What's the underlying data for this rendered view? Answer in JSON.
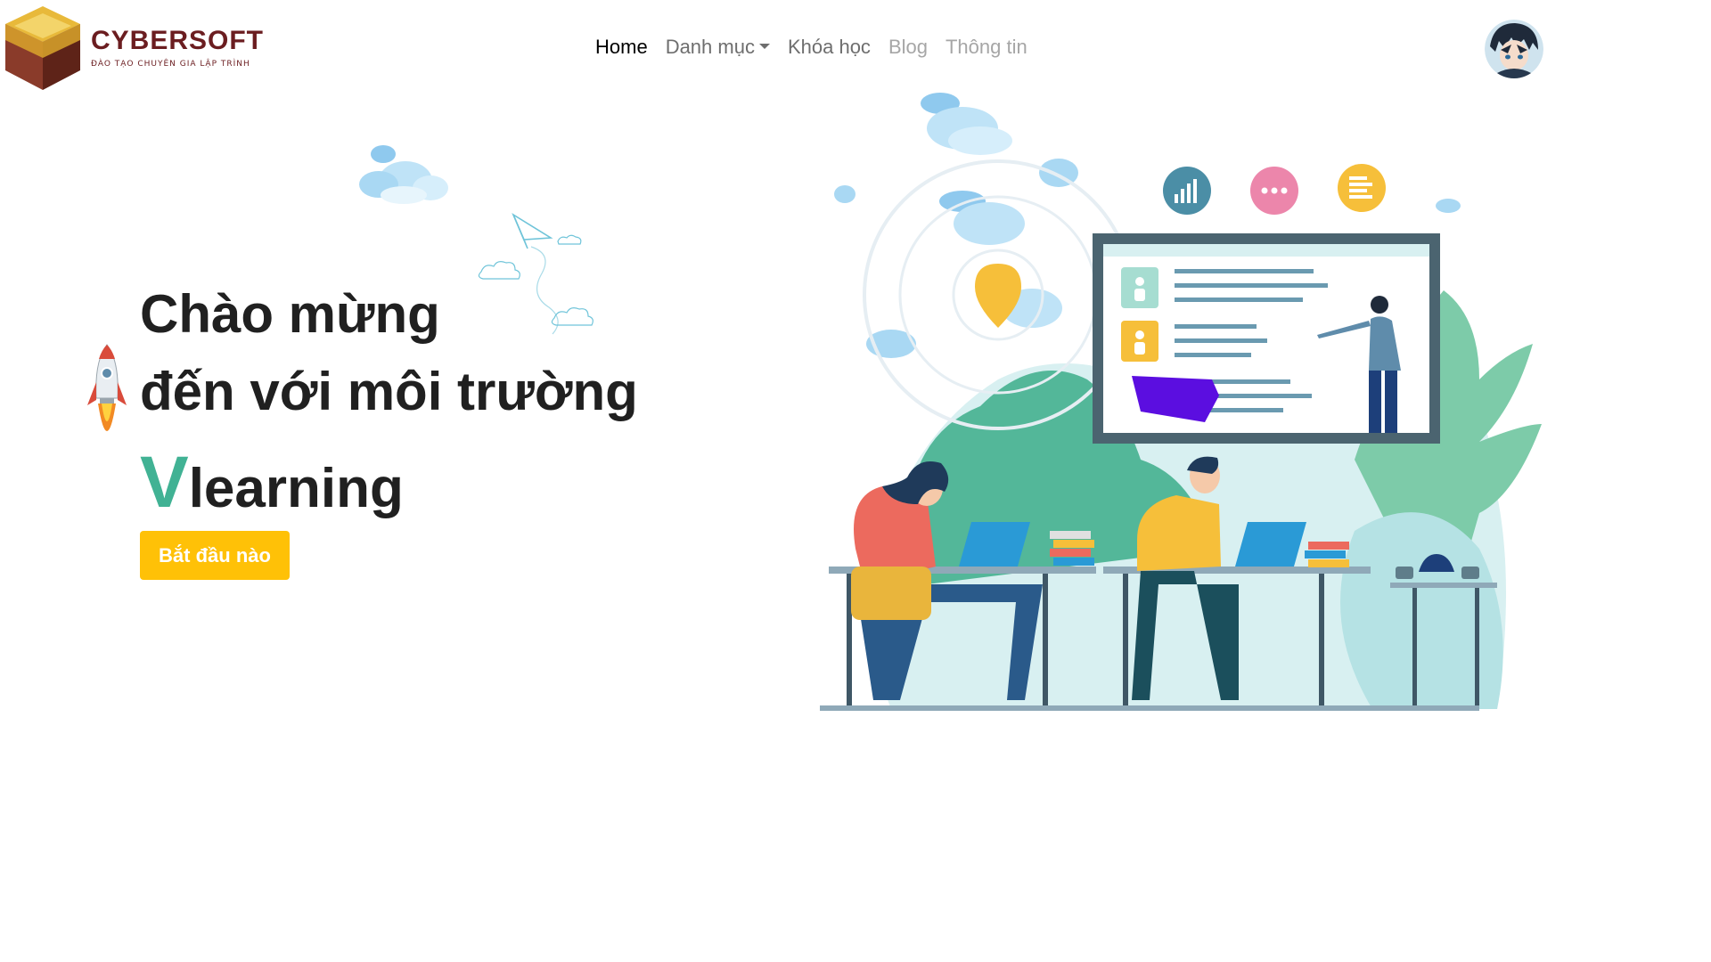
{
  "brand": {
    "name": "CYBERSOFT",
    "tagline": "ĐÀO TẠO CHUYÊN GIA LẬP TRÌNH"
  },
  "nav": {
    "items": [
      {
        "label": "Home",
        "state": "active"
      },
      {
        "label": "Danh mục",
        "state": "normal",
        "dropdown": true
      },
      {
        "label": "Khóa học",
        "state": "normal"
      },
      {
        "label": "Blog",
        "state": "muted"
      },
      {
        "label": "Thông tin",
        "state": "muted"
      }
    ]
  },
  "hero": {
    "line1": "Chào mừng",
    "line2": "đến với môi trường",
    "v_letter": "V",
    "line3_rest": "learning",
    "cta_label": "Bắt đầu nào"
  },
  "colors": {
    "accent_green": "#41b294",
    "cta_yellow": "#ffc107",
    "brand_maroon": "#6b1d20"
  },
  "icons": [
    "rocket-icon",
    "cloud-icon",
    "paper-plane-icon",
    "chart-icon",
    "chat-icon",
    "document-icon",
    "avatar-image"
  ]
}
